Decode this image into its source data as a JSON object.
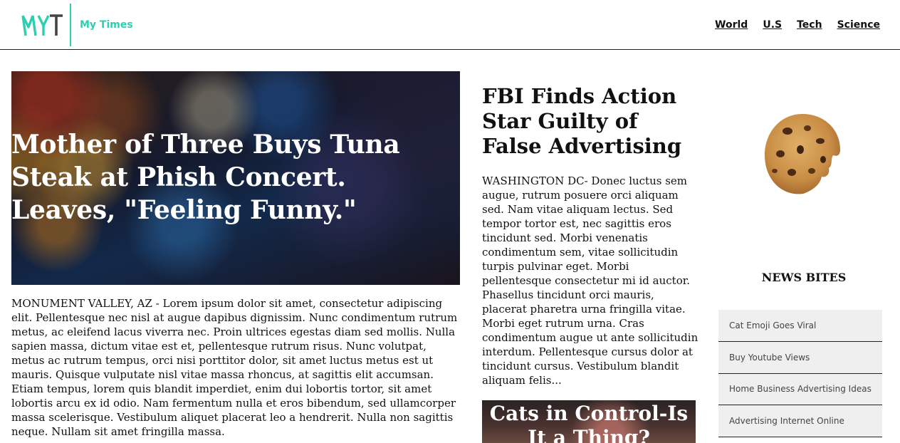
{
  "header": {
    "brand": "My Times",
    "nav": [
      "World",
      "U.S",
      "Tech",
      "Science"
    ]
  },
  "hero": {
    "headline": "Mother of Three Buys Tuna Steak at Phish Concert. Leaves, \"Feeling Funny.\"",
    "body": "MONUMENT VALLEY, AZ - Lorem ipsum dolor sit amet, consectetur adipiscing elit. Pellentesque nec nisl at augue dapibus dignissim. Nunc condimentum rutrum metus, ac eleifend lacus viverra nec. Proin ultrices egestas diam sed mollis. Nulla sapien massa, dictum vitae est et, pellentesque rutrum risus. Nunc volutpat, metus ac rutrum tempus, orci nisi porttitor dolor, sit amet luctus metus est ut mauris. Quisque vulputate nisl vitae massa rhoncus, at sagittis elit accumsan. Etiam tempus, lorem quis blandit imperdiet, enim dui lobortis tortor, sit amet lobortis arcu ex id odio. Nam fermentum nulla et eros bibendum, sed ullamcorper massa scelerisque. Vestibulum aliquet placerat leo a hendrerit. Nulla non sagittis neque. Nullam sit amet fringilla massa."
  },
  "middle": {
    "headline": "FBI Finds Action Star Guilty of False Advertising",
    "body": "WASHINGTON DC- Donec luctus sem augue, rutrum posuere orci aliquam sed. Nam vitae aliquam lectus. Sed tempor tortor est, nec sagittis eros tincidunt sed. Morbi venenatis condimentum sem, vitae sollicitudin turpis pulvinar eget. Morbi pellentesque consectetur mi id auctor. Phasellus tincidunt orci mauris, placerat pharetra urna fringilla vitae. Morbi eget rutrum urna. Cras condimentum augue ut ante sollicitudin interdum. Pellentesque cursus dolor at tincidunt cursus. Vestibulum blandit aliquam felis...",
    "card_headline": "Cats in Control-Is It a Thing?"
  },
  "sidebar": {
    "title": "NEWS BITES",
    "items": [
      "Cat Emoji Goes Viral",
      "Buy Youtube Views",
      "Home Business Advertising Ideas",
      "Advertising Internet Online"
    ]
  },
  "colors": {
    "accent": "#2ecfb0",
    "text": "#111111",
    "list_bg": "#efefef"
  }
}
